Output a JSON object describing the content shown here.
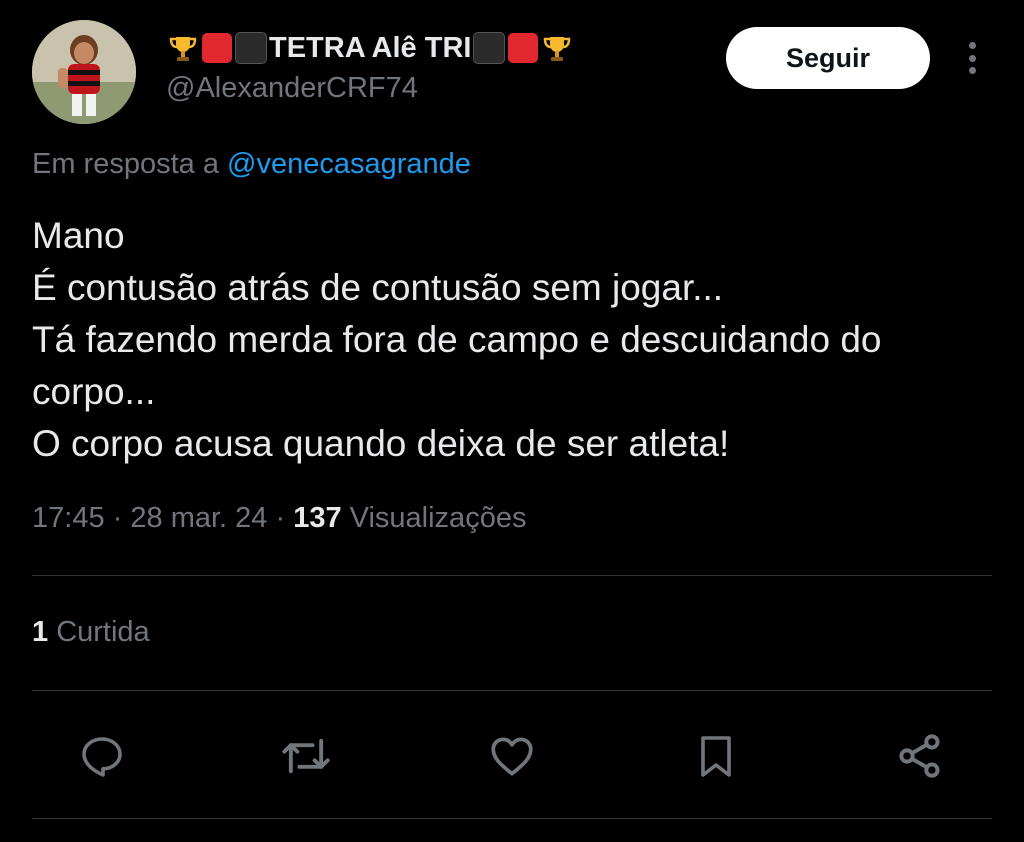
{
  "author": {
    "display_name": "TETRA Alê TRI",
    "handle": "@AlexanderCRF74",
    "name_emojis": [
      "trophy",
      "red-square",
      "black-square",
      "black-square",
      "red-square",
      "trophy"
    ]
  },
  "follow_button": {
    "label": "Seguir"
  },
  "reply_context": {
    "prefix": "Em resposta a",
    "mention": "@venecasagrande"
  },
  "tweet": {
    "lines": [
      "Mano",
      "É contusão atrás de contusão sem jogar...",
      "Tá fazendo merda fora de campo e descuidando do",
      "corpo...",
      "O corpo acusa quando deixa de ser atleta!"
    ]
  },
  "meta": {
    "time": "17:45",
    "separator": "·",
    "date": "28 mar. 24",
    "views_count": "137",
    "views_label": "Visualizações"
  },
  "stats": {
    "likes_count": "1",
    "likes_label": "Curtida"
  },
  "actions": [
    "reply-icon",
    "retweet-icon",
    "like-icon",
    "bookmark-icon",
    "share-icon"
  ],
  "colors": {
    "background": "#000000",
    "text_primary": "#e7e9ea",
    "text_secondary": "#71767b",
    "link": "#1d9bf0",
    "divider": "#2f3336"
  }
}
